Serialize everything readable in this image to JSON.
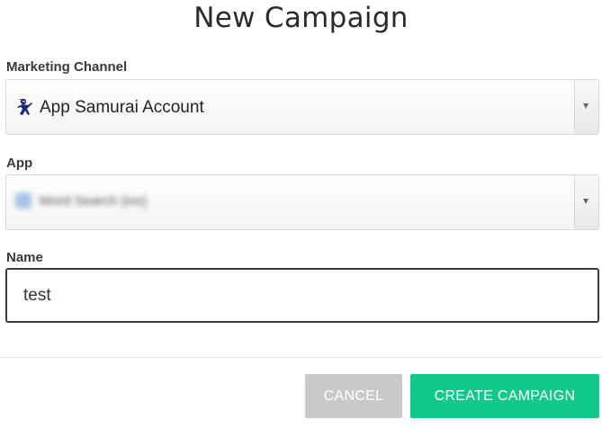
{
  "dialog": {
    "title": "New Campaign"
  },
  "marketing_channel": {
    "label": "Marketing Channel",
    "selected": "App Samurai Account",
    "icon": "samurai-ninja-icon"
  },
  "app": {
    "label": "App",
    "selected": "Word Search (ios)"
  },
  "name": {
    "label": "Name",
    "value": "test"
  },
  "actions": {
    "cancel_label": "CANCEL",
    "create_label": "CREATE CAMPAIGN"
  },
  "colors": {
    "primary": "#13c98a",
    "cancel": "#c9c9c9"
  }
}
